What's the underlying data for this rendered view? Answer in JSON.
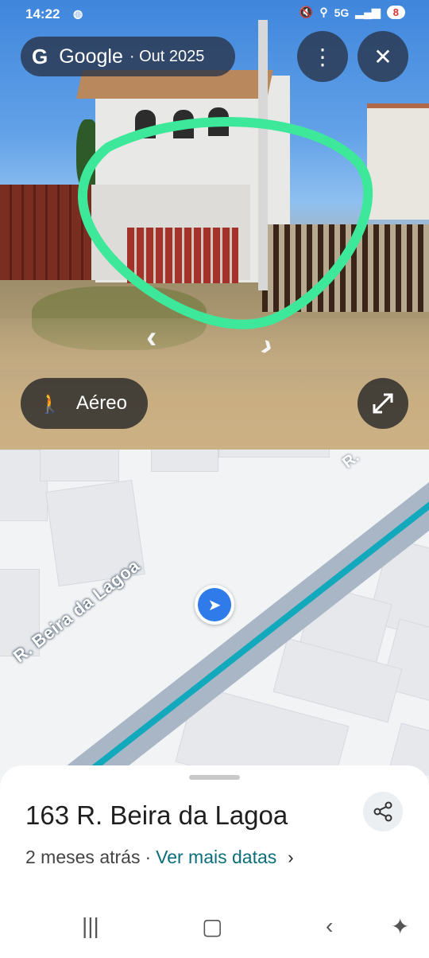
{
  "status_bar": {
    "time": "14:22",
    "left_icon": "notification-icon",
    "right_icons": [
      "mute-icon",
      "location-icon",
      "signal-5g-icon",
      "signal-bars-icon"
    ],
    "network_label": "5G",
    "battery": "8"
  },
  "streetview": {
    "brand": "Google",
    "date": "· Out 2025",
    "menu_icon": "more-vert-icon",
    "close_icon": "close-icon",
    "aereo_label": "Aéreo",
    "expand_icon": "expand-icon",
    "highlight_color": "#3ee89a"
  },
  "map": {
    "street_label": "R. Beira da Lagoa",
    "street_label_partial": "R.",
    "road_color": "#a8b6c6",
    "route_color": "#12a9bd",
    "marker_color": "#2f7bea"
  },
  "sheet": {
    "address": "163 R. Beira da Lagoa",
    "age": "2 meses atrás",
    "separator": "·",
    "link": "Ver mais datas",
    "link_color": "#0b6e7a"
  },
  "nav_bar": {
    "icons": [
      "recent-apps-icon",
      "home-icon",
      "back-icon",
      "accessibility-icon"
    ]
  }
}
